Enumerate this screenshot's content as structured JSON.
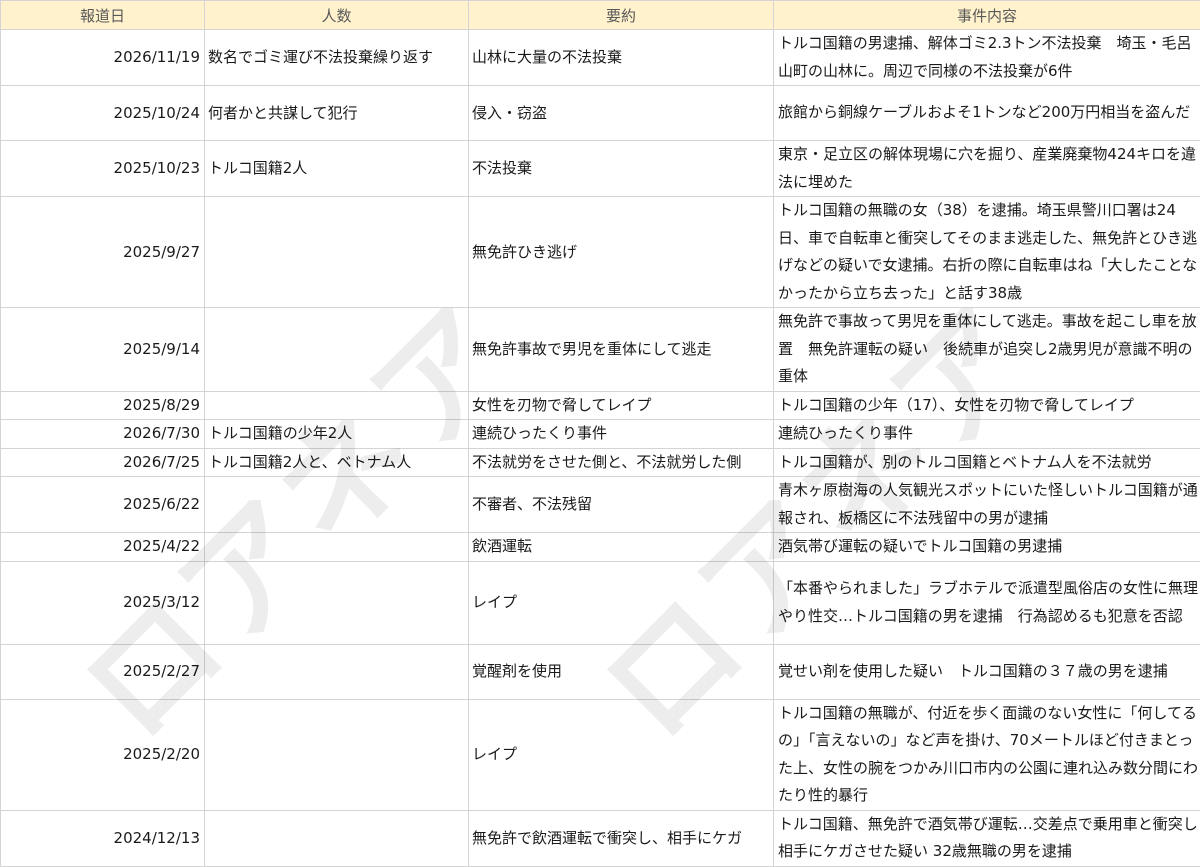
{
  "table": {
    "headers": [
      "報道日",
      "人数",
      "要約",
      "事件内容"
    ],
    "rows": [
      {
        "date": "2026/11/19",
        "people": "数名でゴミ運び不法投棄繰り返す",
        "summary": "山林に大量の不法投棄",
        "detail": "トルコ国籍の男逮捕、解体ゴミ2.3トン不法投棄　埼玉・毛呂山町の山林に。周辺で同様の不法投棄が6件"
      },
      {
        "date": "2025/10/24",
        "people": "何者かと共謀して犯行",
        "summary": "侵入・窃盗",
        "detail": "旅館から銅線ケーブルおよそ1トンなど200万円相当を盗んだ"
      },
      {
        "date": "2025/10/23",
        "people": "トルコ国籍2人",
        "summary": "不法投棄",
        "detail": "東京・足立区の解体現場に穴を掘り、産業廃棄物424キロを違法に埋めた"
      },
      {
        "date": "2025/9/27",
        "people": "",
        "summary": "無免許ひき逃げ",
        "detail": "トルコ国籍の無職の女（38）を逮捕。埼玉県警川口署は24日、車で自転車と衝突してそのまま逃走した、無免許とひき逃げなどの疑いで女逮捕。右折の際に自転車はね「大したことなかったから立ち去った」と話す38歳"
      },
      {
        "date": "2025/9/14",
        "people": "",
        "summary": "無免許事故で男児を重体にして逃走",
        "detail": "無免許で事故って男児を重体にして逃走。事故を起こし車を放置　無免許運転の疑い　後続車が追突し2歳男児が意識不明の重体"
      },
      {
        "date": "2025/8/29",
        "people": "",
        "summary": "女性を刃物で脅してレイプ",
        "detail": "トルコ国籍の少年（17）、女性を刃物で脅してレイプ"
      },
      {
        "date": "2026/7/30",
        "people": "トルコ国籍の少年2人",
        "summary": "連続ひったくり事件",
        "detail": "連続ひったくり事件"
      },
      {
        "date": "2026/7/25",
        "people": "トルコ国籍2人と、ベトナム人",
        "summary": "不法就労をさせた側と、不法就労した側",
        "detail": "トルコ国籍が、別のトルコ国籍とベトナム人を不法就労"
      },
      {
        "date": "2025/6/22",
        "people": "",
        "summary": "不審者、不法残留",
        "detail": "青木ヶ原樹海の人気観光スポットにいた怪しいトルコ国籍が通報され、板橋区に不法残留中の男が逮捕"
      },
      {
        "date": "2025/4/22",
        "people": "",
        "summary": "飲酒運転",
        "detail": "酒気帯び運転の疑いでトルコ国籍の男逮捕"
      },
      {
        "date": "2025/3/12",
        "people": "",
        "summary": "レイプ",
        "detail": "「本番やられました」ラブホテルで派遣型風俗店の女性に無理やり性交…トルコ国籍の男を逮捕　行為認めるも犯意を否認"
      },
      {
        "date": "2025/2/27",
        "people": "",
        "summary": "覚醒剤を使用",
        "detail": "覚せい剤を使用した疑い　トルコ国籍の３７歳の男を逮捕"
      },
      {
        "date": "2025/2/20",
        "people": "",
        "summary": "レイプ",
        "detail": "トルコ国籍の無職が、付近を歩く面識のない女性に「何してるの」「言えないの」など声を掛け、70メートルほど付きまとった上、女性の腕をつかみ川口市内の公園に連れ込み数分間にわたり性的暴行"
      },
      {
        "date": "2024/12/13",
        "people": "",
        "summary": "無免許で飲酒運転で衝突し、相手にケガ",
        "detail": "トルコ国籍、無免許で酒気帯び運転…交差点で乗用車と衝突し相手にケガさせた疑い 32歳無職の男を逮捕"
      }
    ]
  },
  "watermark": {
    "text": "ロアネア"
  }
}
